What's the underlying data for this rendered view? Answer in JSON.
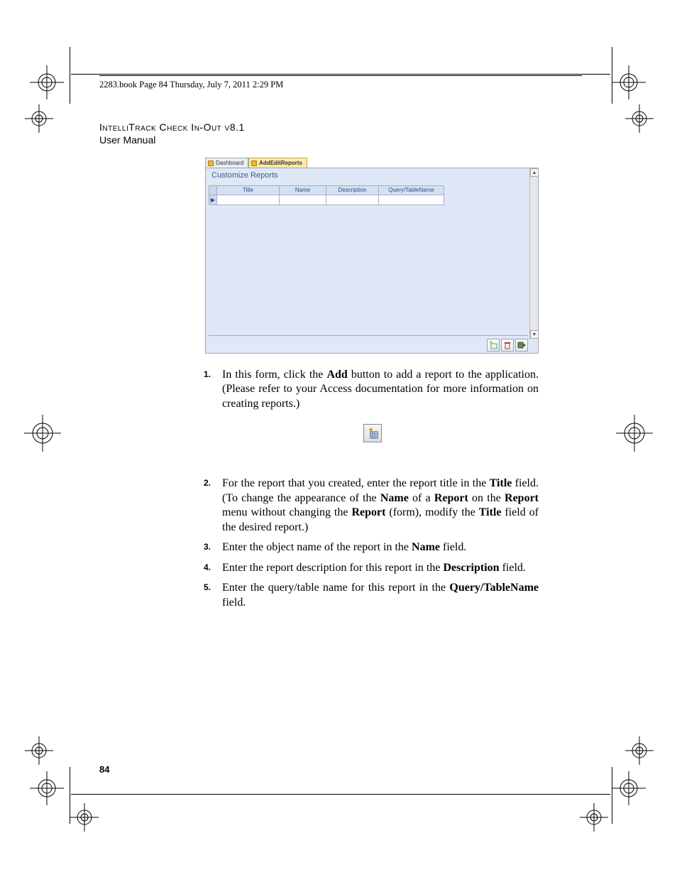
{
  "running_head": "2283.book  Page 84  Thursday, July 7, 2011  2:29 PM",
  "title": {
    "line1": "IntelliTrack Check In-Out v8.1",
    "line2": "User Manual"
  },
  "figure": {
    "tabs": [
      {
        "label": "Dashboard",
        "active": false
      },
      {
        "label": "AddEditReports",
        "active": true
      }
    ],
    "panel_title": "Customize Reports",
    "columns": [
      "Title",
      "Name",
      "Description",
      "Query/TableName"
    ],
    "toolbar_buttons": [
      {
        "name": "add-button",
        "icon": "new"
      },
      {
        "name": "delete-button",
        "icon": "delete"
      },
      {
        "name": "close-button",
        "icon": "close"
      }
    ]
  },
  "steps": {
    "s1": {
      "num": "1.",
      "pre": "In this form, click the ",
      "bold1": "Add",
      "post": " button to add a report to the application. (Please refer to your Access documentation for more information on creating reports.)"
    },
    "s2": {
      "num": "2.",
      "pre": "For the report that you created, enter the report title in the ",
      "b1": "Title",
      "t1": " field. (To change the appearance of the ",
      "b2": "Name",
      "t2": " of a ",
      "b3": "Report",
      "t3": " on the ",
      "b4": "Report",
      "t4": " menu without changing the ",
      "b5": "Report",
      "t5": " (form), modify the ",
      "b6": "Title",
      "t6": " field of the desired report.)"
    },
    "s3": {
      "num": "3.",
      "pre": "Enter the object name of the report in the ",
      "b1": "Name",
      "post": " field."
    },
    "s4": {
      "num": "4.",
      "pre": "Enter the report description for this report in the ",
      "b1": "Description",
      "post": " field."
    },
    "s5": {
      "num": "5.",
      "pre": "Enter the query/table name for this report in the ",
      "b1": "Query/TableName",
      "post": " field."
    }
  },
  "page_number": "84"
}
